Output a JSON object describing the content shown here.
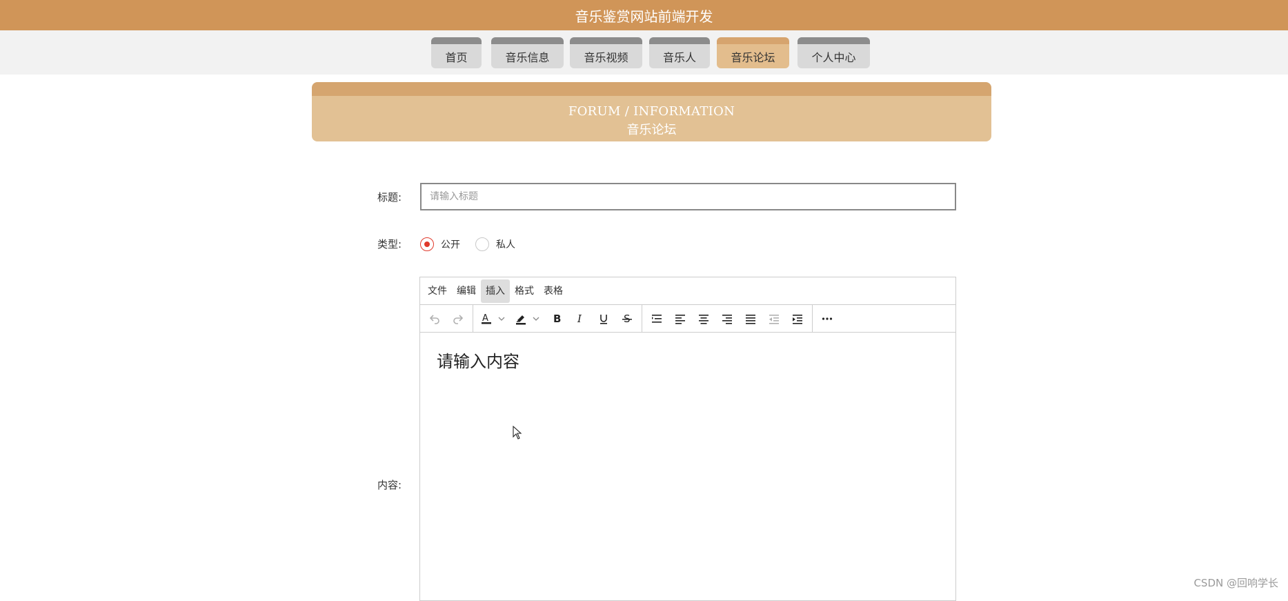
{
  "header": {
    "title": "音乐鉴赏网站前端开发"
  },
  "nav": {
    "tabs": [
      {
        "label": "首页"
      },
      {
        "label": "音乐信息"
      },
      {
        "label": "音乐视频"
      },
      {
        "label": "音乐人"
      },
      {
        "label": "音乐论坛",
        "active": true
      },
      {
        "label": "个人中心"
      }
    ]
  },
  "banner": {
    "en": "FORUM / INFORMATION",
    "cn": "音乐论坛"
  },
  "form": {
    "title_label": "标题:",
    "title_placeholder": "请输入标题",
    "title_value": "",
    "type_label": "类型:",
    "type_options": [
      "公开",
      "私人"
    ],
    "type_selected": "公开",
    "content_label": "内容:"
  },
  "editor": {
    "menu": [
      "文件",
      "编辑",
      "插入",
      "格式",
      "表格"
    ],
    "active_menu": "插入",
    "placeholder": "请输入内容",
    "toolbar_icons": [
      "undo-icon",
      "redo-icon",
      "text-color-icon",
      "highlight-color-icon",
      "bold-icon",
      "italic-icon",
      "underline-icon",
      "strikethrough-icon",
      "line-height-icon",
      "align-left-icon",
      "align-center-icon",
      "align-right-icon",
      "align-justify-icon",
      "outdent-icon",
      "indent-icon",
      "more-icon"
    ]
  },
  "watermark": {
    "text": "CSDN @回响学长"
  },
  "colors": {
    "topbar": "#d09558",
    "nav_active": "#e3bd8d",
    "nav_tab": "#d9d9d9",
    "banner": "#e2c194",
    "radio_checked": "#e0392b"
  }
}
